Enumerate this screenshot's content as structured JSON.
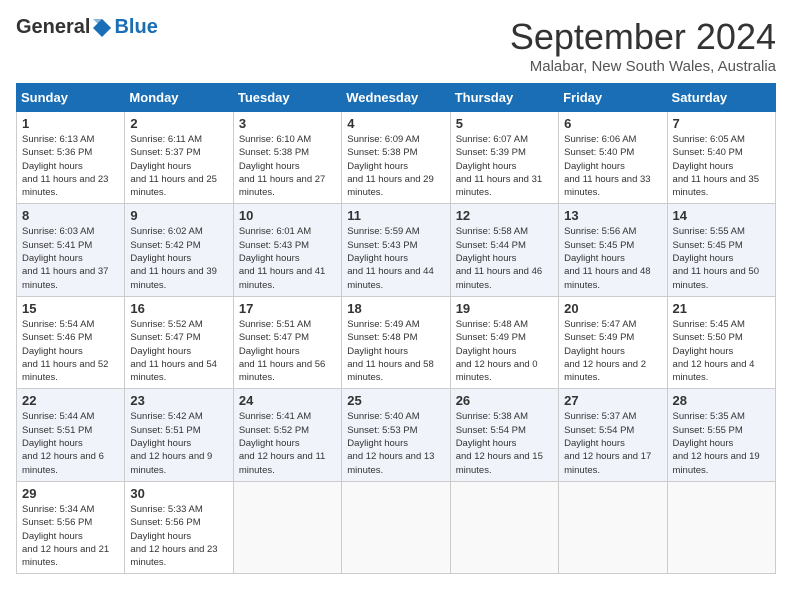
{
  "header": {
    "logo_general": "General",
    "logo_blue": "Blue",
    "title": "September 2024",
    "location": "Malabar, New South Wales, Australia"
  },
  "calendar": {
    "days_of_week": [
      "Sunday",
      "Monday",
      "Tuesday",
      "Wednesday",
      "Thursday",
      "Friday",
      "Saturday"
    ],
    "weeks": [
      [
        null,
        null,
        null,
        null,
        null,
        null,
        null
      ]
    ]
  },
  "days": {
    "d1": {
      "num": "1",
      "sunrise": "6:13 AM",
      "sunset": "5:36 PM",
      "daylight": "11 hours and 23 minutes."
    },
    "d2": {
      "num": "2",
      "sunrise": "6:11 AM",
      "sunset": "5:37 PM",
      "daylight": "11 hours and 25 minutes."
    },
    "d3": {
      "num": "3",
      "sunrise": "6:10 AM",
      "sunset": "5:38 PM",
      "daylight": "11 hours and 27 minutes."
    },
    "d4": {
      "num": "4",
      "sunrise": "6:09 AM",
      "sunset": "5:38 PM",
      "daylight": "11 hours and 29 minutes."
    },
    "d5": {
      "num": "5",
      "sunrise": "6:07 AM",
      "sunset": "5:39 PM",
      "daylight": "11 hours and 31 minutes."
    },
    "d6": {
      "num": "6",
      "sunrise": "6:06 AM",
      "sunset": "5:40 PM",
      "daylight": "11 hours and 33 minutes."
    },
    "d7": {
      "num": "7",
      "sunrise": "6:05 AM",
      "sunset": "5:40 PM",
      "daylight": "11 hours and 35 minutes."
    },
    "d8": {
      "num": "8",
      "sunrise": "6:03 AM",
      "sunset": "5:41 PM",
      "daylight": "11 hours and 37 minutes."
    },
    "d9": {
      "num": "9",
      "sunrise": "6:02 AM",
      "sunset": "5:42 PM",
      "daylight": "11 hours and 39 minutes."
    },
    "d10": {
      "num": "10",
      "sunrise": "6:01 AM",
      "sunset": "5:43 PM",
      "daylight": "11 hours and 41 minutes."
    },
    "d11": {
      "num": "11",
      "sunrise": "5:59 AM",
      "sunset": "5:43 PM",
      "daylight": "11 hours and 44 minutes."
    },
    "d12": {
      "num": "12",
      "sunrise": "5:58 AM",
      "sunset": "5:44 PM",
      "daylight": "11 hours and 46 minutes."
    },
    "d13": {
      "num": "13",
      "sunrise": "5:56 AM",
      "sunset": "5:45 PM",
      "daylight": "11 hours and 48 minutes."
    },
    "d14": {
      "num": "14",
      "sunrise": "5:55 AM",
      "sunset": "5:45 PM",
      "daylight": "11 hours and 50 minutes."
    },
    "d15": {
      "num": "15",
      "sunrise": "5:54 AM",
      "sunset": "5:46 PM",
      "daylight": "11 hours and 52 minutes."
    },
    "d16": {
      "num": "16",
      "sunrise": "5:52 AM",
      "sunset": "5:47 PM",
      "daylight": "11 hours and 54 minutes."
    },
    "d17": {
      "num": "17",
      "sunrise": "5:51 AM",
      "sunset": "5:47 PM",
      "daylight": "11 hours and 56 minutes."
    },
    "d18": {
      "num": "18",
      "sunrise": "5:49 AM",
      "sunset": "5:48 PM",
      "daylight": "11 hours and 58 minutes."
    },
    "d19": {
      "num": "19",
      "sunrise": "5:48 AM",
      "sunset": "5:49 PM",
      "daylight": "12 hours and 0 minutes."
    },
    "d20": {
      "num": "20",
      "sunrise": "5:47 AM",
      "sunset": "5:49 PM",
      "daylight": "12 hours and 2 minutes."
    },
    "d21": {
      "num": "21",
      "sunrise": "5:45 AM",
      "sunset": "5:50 PM",
      "daylight": "12 hours and 4 minutes."
    },
    "d22": {
      "num": "22",
      "sunrise": "5:44 AM",
      "sunset": "5:51 PM",
      "daylight": "12 hours and 6 minutes."
    },
    "d23": {
      "num": "23",
      "sunrise": "5:42 AM",
      "sunset": "5:51 PM",
      "daylight": "12 hours and 9 minutes."
    },
    "d24": {
      "num": "24",
      "sunrise": "5:41 AM",
      "sunset": "5:52 PM",
      "daylight": "12 hours and 11 minutes."
    },
    "d25": {
      "num": "25",
      "sunrise": "5:40 AM",
      "sunset": "5:53 PM",
      "daylight": "12 hours and 13 minutes."
    },
    "d26": {
      "num": "26",
      "sunrise": "5:38 AM",
      "sunset": "5:54 PM",
      "daylight": "12 hours and 15 minutes."
    },
    "d27": {
      "num": "27",
      "sunrise": "5:37 AM",
      "sunset": "5:54 PM",
      "daylight": "12 hours and 17 minutes."
    },
    "d28": {
      "num": "28",
      "sunrise": "5:35 AM",
      "sunset": "5:55 PM",
      "daylight": "12 hours and 19 minutes."
    },
    "d29": {
      "num": "29",
      "sunrise": "5:34 AM",
      "sunset": "5:56 PM",
      "daylight": "12 hours and 21 minutes."
    },
    "d30": {
      "num": "30",
      "sunrise": "5:33 AM",
      "sunset": "5:56 PM",
      "daylight": "12 hours and 23 minutes."
    }
  }
}
